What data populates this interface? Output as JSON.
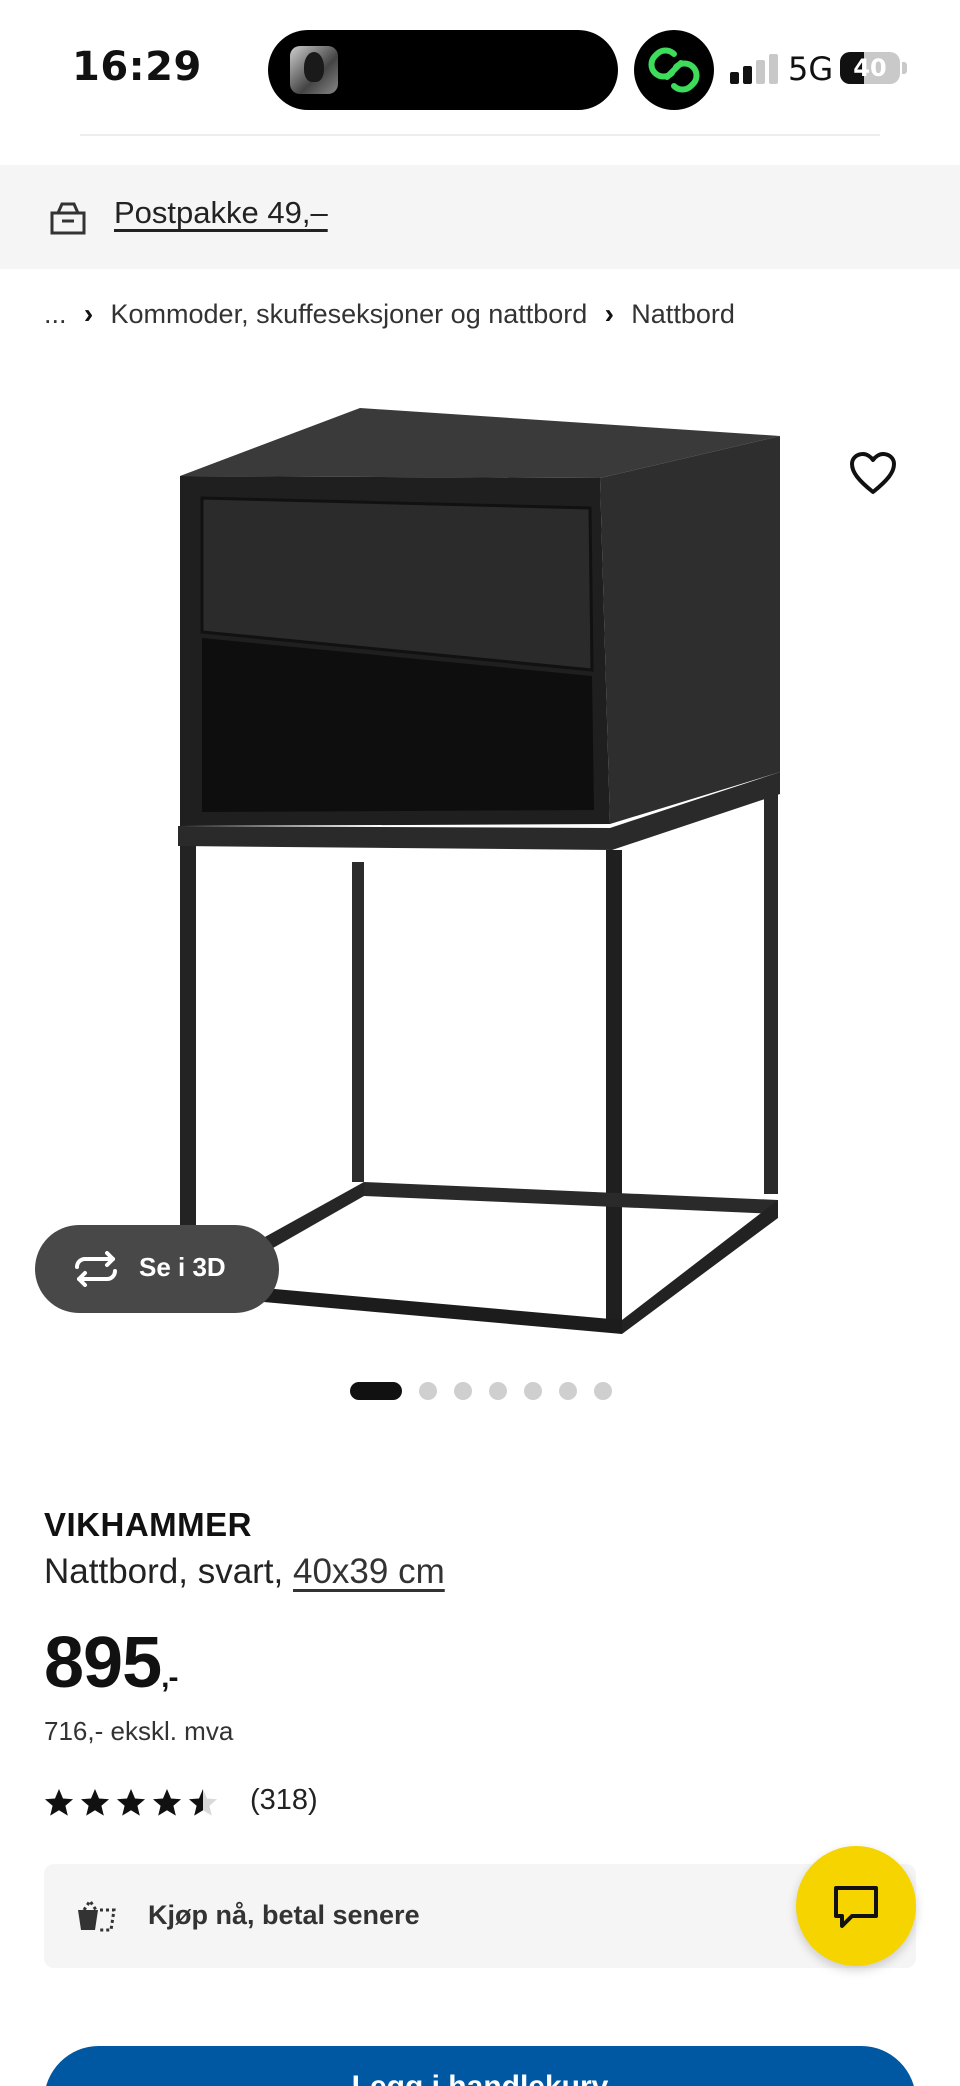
{
  "status_bar": {
    "time": "16:29",
    "network": "5G",
    "battery": "40",
    "battery_level": 0.4
  },
  "delivery": {
    "text": "Postpakke 49,–"
  },
  "breadcrumb": {
    "ellipsis": "...",
    "items": [
      "Kommoder, skuffeseksjoner og nattbord",
      "Nattbord"
    ]
  },
  "gallery": {
    "view_3d_label": "Se i 3D",
    "image_count": 7,
    "active_index": 0
  },
  "product": {
    "name": "VIKHAMMER",
    "description": "Nattbord, svart,",
    "size": "40x39 cm",
    "price": "895",
    "price_suffix": ",-",
    "price_ex_vat": "716,- ekskl. mva",
    "rating_value": 4.5,
    "rating_max": 5,
    "review_count": "(318)"
  },
  "financing": {
    "label": "Kjøp nå, betal senere"
  },
  "cta": {
    "label": "Legg i handlekurv"
  },
  "icons": {
    "delivery": "truck-icon",
    "favourite": "heart-icon",
    "rotate_3d": "rotate-3d-icon",
    "financing": "basket-icon",
    "chat": "chat-bubble-icon"
  },
  "colors": {
    "ikea_blue": "#0058a3",
    "ikea_yellow": "#f6d400",
    "banner_bg": "#f5f5f5",
    "text": "#111111"
  }
}
